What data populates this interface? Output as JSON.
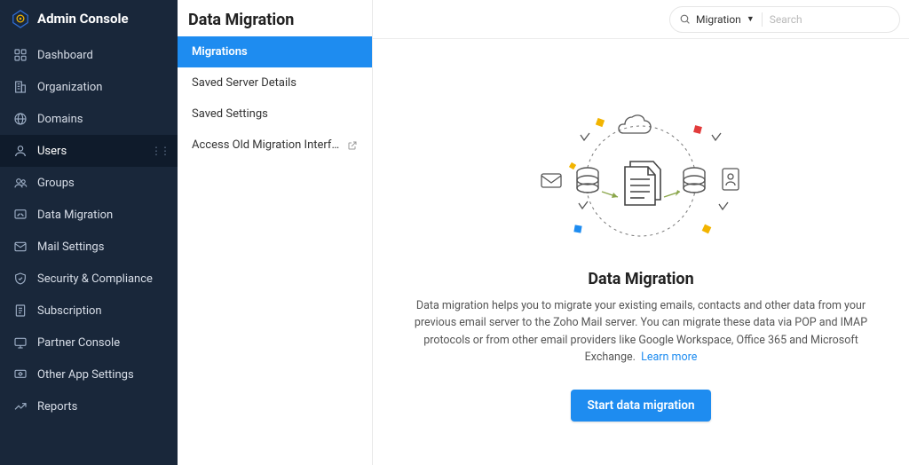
{
  "brand": {
    "title": "Admin Console"
  },
  "sidebar": {
    "items": [
      {
        "label": "Dashboard"
      },
      {
        "label": "Organization"
      },
      {
        "label": "Domains"
      },
      {
        "label": "Users"
      },
      {
        "label": "Groups"
      },
      {
        "label": "Data Migration"
      },
      {
        "label": "Mail Settings"
      },
      {
        "label": "Security & Compliance"
      },
      {
        "label": "Subscription"
      },
      {
        "label": "Partner Console"
      },
      {
        "label": "Other App Settings"
      },
      {
        "label": "Reports"
      }
    ]
  },
  "page": {
    "title": "Data Migration"
  },
  "subnav": {
    "items": [
      {
        "label": "Migrations"
      },
      {
        "label": "Saved Server Details"
      },
      {
        "label": "Saved Settings"
      },
      {
        "label": "Access Old Migration Interfa..."
      }
    ]
  },
  "search": {
    "scope": "Migration",
    "placeholder": "Search"
  },
  "empty": {
    "title": "Data Migration",
    "body": "Data migration helps you to migrate your existing emails, contacts and other data from your previous email server to the Zoho Mail server. You can migrate these data via POP and IMAP protocols or from other email providers like Google Workspace, Office 365 and Microsoft Exchange.",
    "learn": "Learn more",
    "cta": "Start data migration"
  },
  "colors": {
    "accent": "#1e8cf0",
    "sidebar_bg": "#19273a"
  }
}
